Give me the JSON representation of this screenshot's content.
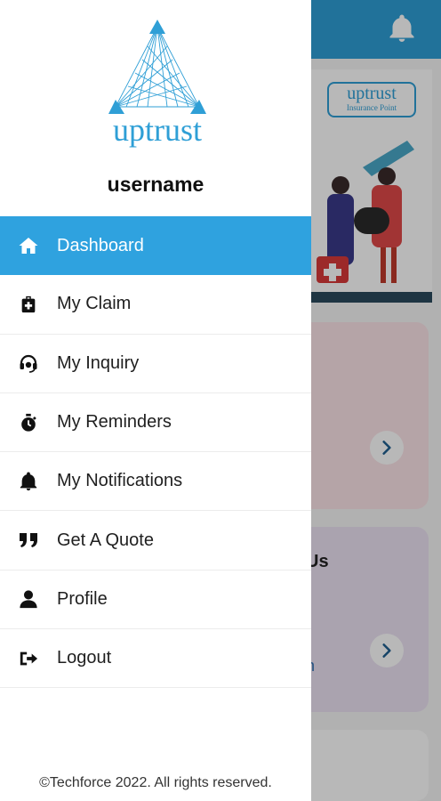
{
  "drawer": {
    "logo_text": "uptrust",
    "username": "username",
    "menu": [
      {
        "label": "Dashboard",
        "icon": "home-icon",
        "active": true
      },
      {
        "label": "My Claim",
        "icon": "medical-bag-icon",
        "active": false
      },
      {
        "label": "My Inquiry",
        "icon": "headset-icon",
        "active": false
      },
      {
        "label": "My Reminders",
        "icon": "stopwatch-icon",
        "active": false
      },
      {
        "label": "My Notifications",
        "icon": "bell-icon",
        "active": false
      },
      {
        "label": "Get A Quote",
        "icon": "quote-icon",
        "active": false
      },
      {
        "label": "Profile",
        "icon": "user-icon",
        "active": false
      },
      {
        "label": "Logout",
        "icon": "logout-icon",
        "active": false
      }
    ],
    "footer": "©Techforce 2022. All rights reserved."
  },
  "background": {
    "banner_logo_line1": "uptrust",
    "banner_logo_line2": "Insurance Point",
    "card2_title_fragment": "Us",
    "card1_text_fragment": ")",
    "card2_text_fragment": "n"
  },
  "colors": {
    "accent": "#2fa2df",
    "appbar": "#2f9fd6",
    "card_pink": "#fbe3e8",
    "card_purple": "#ece2f3"
  }
}
